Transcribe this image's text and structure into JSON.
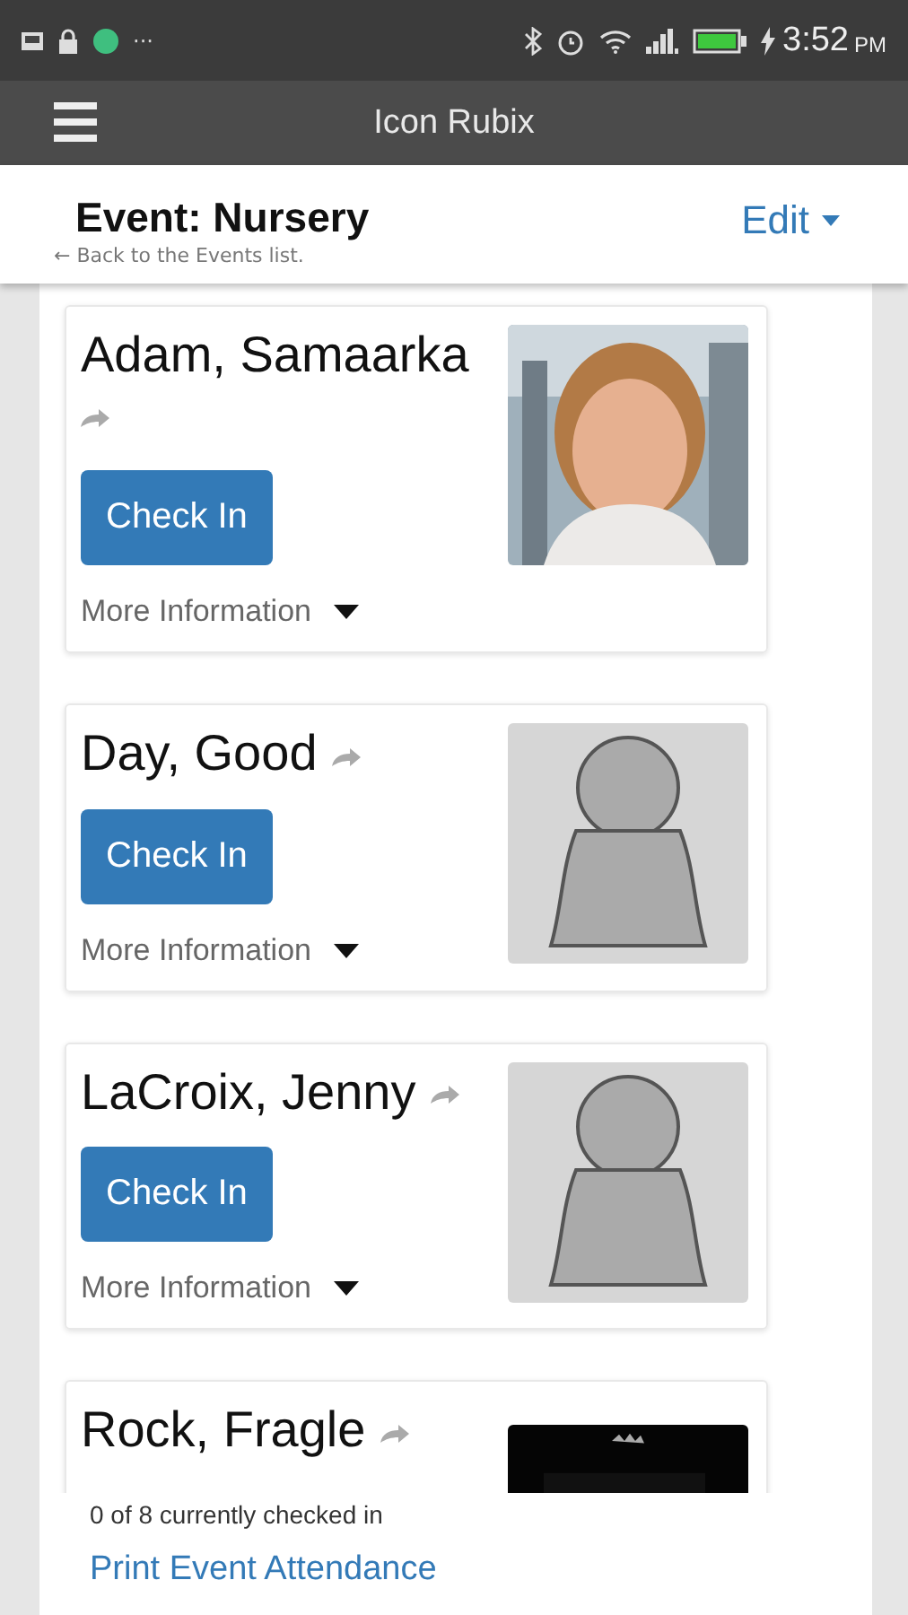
{
  "status_bar": {
    "time": "3:52",
    "ampm": "PM",
    "notification_dots": "···"
  },
  "app_bar": {
    "title": "Icon Rubix"
  },
  "header": {
    "title": "Event: Nursery",
    "back_link": "← Back to the Events list.",
    "edit_menu": "Edit"
  },
  "people": [
    {
      "name": "Adam, Samaarka",
      "button": "Check In",
      "more": "More Information"
    },
    {
      "name": "Day, Good",
      "button": "Check In",
      "more": "More Information",
      "kind": "placeholder"
    },
    {
      "name": "LaCroix, Jenny",
      "button": "Check In",
      "more": "More Information",
      "kind": "placeholder"
    },
    {
      "name": "Rock, Fragle",
      "kind": "dark_photo"
    }
  ],
  "footer": {
    "count": "0 of 8 currently checked in",
    "print_link": "Print Event Attendance"
  }
}
